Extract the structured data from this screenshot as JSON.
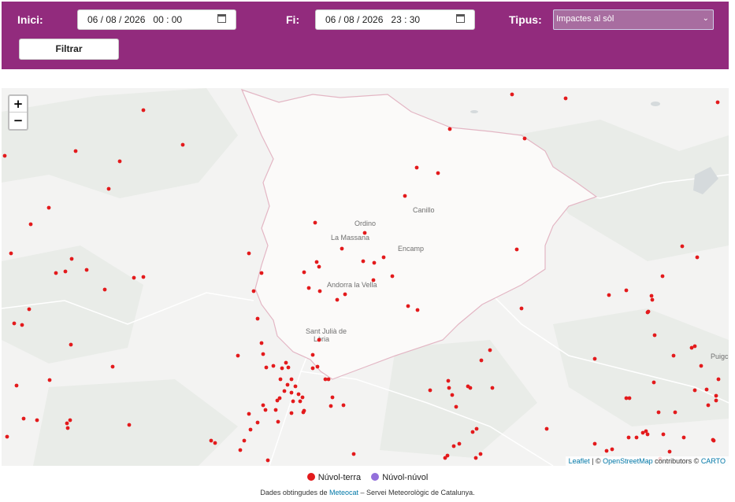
{
  "filters": {
    "start_label": "Inici:",
    "start_value": "06 / 08 / 2026   00 : 00",
    "end_label": "Fi:",
    "end_value": "06 / 08 / 2026   23 : 30",
    "type_label": "Tipus:",
    "type_value": "Impactes al sòl",
    "filter_button": "Filtrar"
  },
  "map": {
    "zoom_in": "+",
    "zoom_out": "−",
    "towns": [
      "Ordino",
      "Canillo",
      "La Massana",
      "Encamp",
      "Andorra la Vella",
      "Sant Julià de",
      "Lòria",
      "Puigc"
    ],
    "attribution": {
      "leaflet": "Leaflet",
      "sep1": " | © ",
      "osm": "OpenStreetMap",
      "mid": " contributors © ",
      "carto": "CARTO"
    },
    "strike_color": "#e31a1c",
    "cloud_color": "#9370db"
  },
  "legend": {
    "ground": "Núvol-terra",
    "cloud": "Núvol-núvol"
  },
  "credit": {
    "prefix": "Dades obtingudes de ",
    "link": "Meteocat",
    "suffix": " – Servei Meteorològic de Catalunya."
  }
}
